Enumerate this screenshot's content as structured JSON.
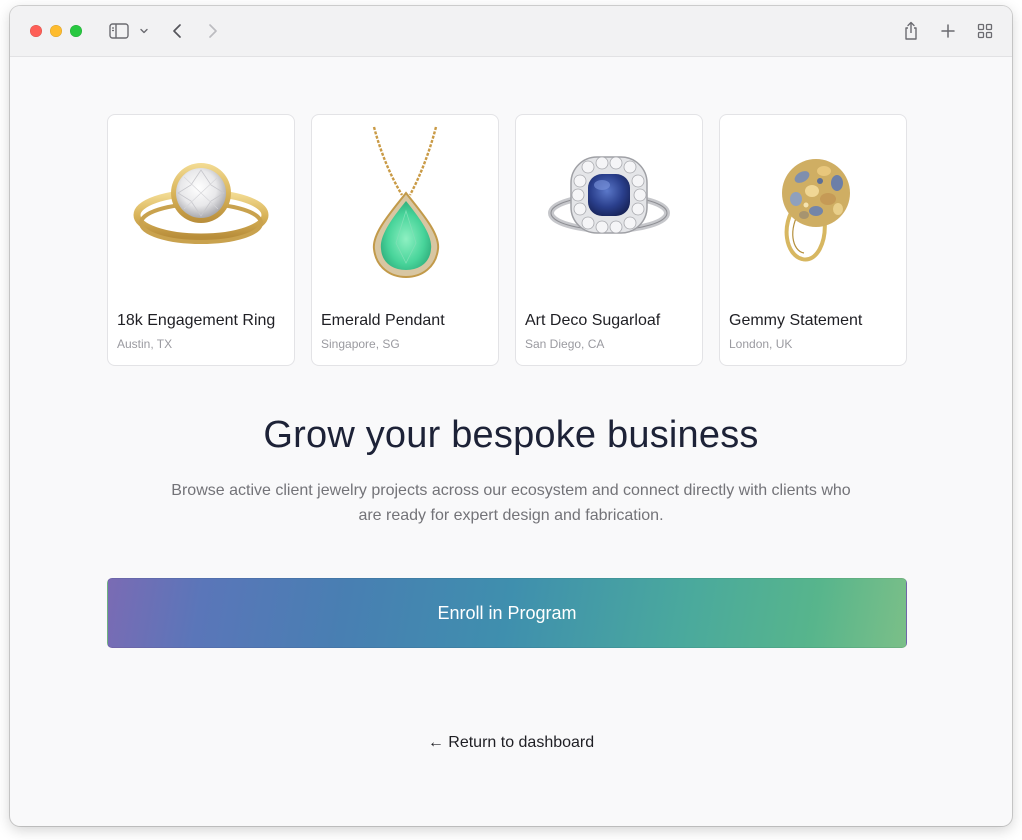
{
  "browser": {
    "icons": [
      "sidebar-icon",
      "chevron-down-icon",
      "back-icon",
      "forward-icon",
      "share-icon",
      "new-tab-icon",
      "tab-overview-icon"
    ]
  },
  "projects": [
    {
      "title": "18k Engagement Ring",
      "location": "Austin, TX",
      "image": "gold-solitaire-ring"
    },
    {
      "title": "Emerald Pendant",
      "location": "Singapore, SG",
      "image": "pear-emerald-pendant"
    },
    {
      "title": "Art Deco Sugarloaf",
      "location": "San Diego, CA",
      "image": "sapphire-halo-ring"
    },
    {
      "title": "Gemmy Statement",
      "location": "London, UK",
      "image": "cluster-gem-ring"
    }
  ],
  "hero": {
    "headline": "Grow your bespoke business",
    "subtext": "Browse active client jewelry projects across our ecosystem and connect directly with clients who are ready for expert design and fabrication."
  },
  "cta": {
    "enroll_label": "Enroll in Program"
  },
  "footer": {
    "back_label": "← Return to dashboard"
  },
  "colors": {
    "headline": "#1d2237",
    "gradient_start": "#7a6bb4",
    "gradient_mid": "#3f8fae",
    "gradient_end": "#7bbf88"
  }
}
